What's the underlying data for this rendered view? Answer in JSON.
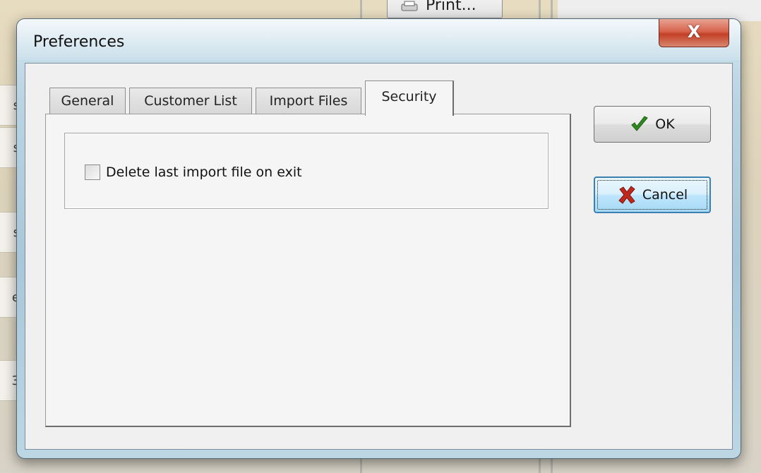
{
  "background": {
    "print_button_label": "Print..."
  },
  "dialog": {
    "title": "Preferences",
    "close_glyph": "X",
    "tabs": [
      {
        "label": "General",
        "active": false
      },
      {
        "label": "Customer List",
        "active": false
      },
      {
        "label": "Import Files",
        "active": false
      },
      {
        "label": "Security",
        "active": true
      }
    ],
    "security": {
      "delete_last_import_label": "Delete last import file on exit",
      "delete_last_import_checked": false
    },
    "ok_label": "OK",
    "cancel_label": "Cancel"
  },
  "icons": {
    "ok": "checkmark-icon",
    "cancel": "x-mark-icon",
    "print": "printer-icon"
  },
  "colors": {
    "ok_check": "#2e8b1f",
    "cancel_x": "#c0281b",
    "focus_border": "#3c7fb1"
  }
}
